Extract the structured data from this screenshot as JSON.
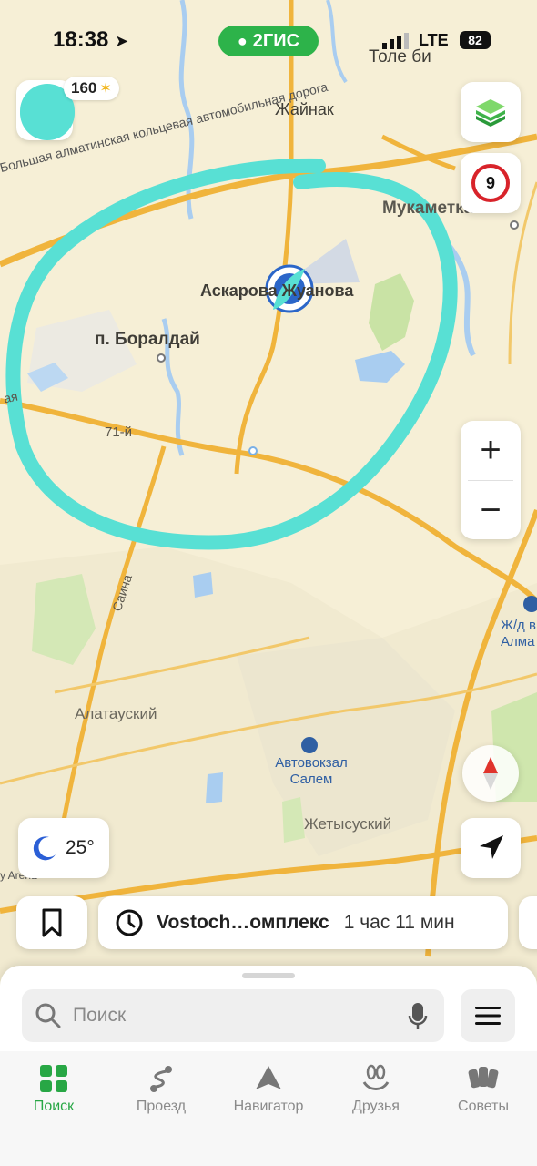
{
  "status_bar": {
    "time": "18:38",
    "brand": "2ГИС",
    "network": "LTE",
    "battery": "82",
    "location_label": "Толе би"
  },
  "profile": {
    "score": "160"
  },
  "speed_limit": "9",
  "map_labels": {
    "zhainak": "Жайнак",
    "ring_road": "Большая алматинская кольцевая автомобильная дорога",
    "mukametkan": "Мукаметкан Т",
    "askarov": "Аскарова Жуанова",
    "boraldai": "п. Боралдай",
    "road_71": "71-й",
    "road_left": "ая",
    "saina": "Саина",
    "alatau": "Алатауский",
    "avtovokzal": "Автовокзал Салем",
    "zhetysu": "Жетысуский",
    "railway": "Ж/д в Алма",
    "arena": "y Arena"
  },
  "weather": {
    "temp": "25°",
    "icon": "moon-icon"
  },
  "route": {
    "destination": "Vostoch…омплекс",
    "eta": "1 час 11 мин"
  },
  "search": {
    "placeholder": "Поиск"
  },
  "tabs": [
    {
      "label": "Поиск",
      "icon": "grid-icon",
      "active": true
    },
    {
      "label": "Проезд",
      "icon": "route-icon",
      "active": false
    },
    {
      "label": "Навигатор",
      "icon": "navigator-icon",
      "active": false
    },
    {
      "label": "Друзья",
      "icon": "friends-icon",
      "active": false
    },
    {
      "label": "Советы",
      "icon": "tips-icon",
      "active": false
    }
  ],
  "colors": {
    "brand_green": "#2db34a",
    "annotation": "#58e0d4",
    "road": "#f0b43c",
    "water": "#a9cdf0",
    "park": "#c9e3a5",
    "speed_red": "#d8232a"
  }
}
